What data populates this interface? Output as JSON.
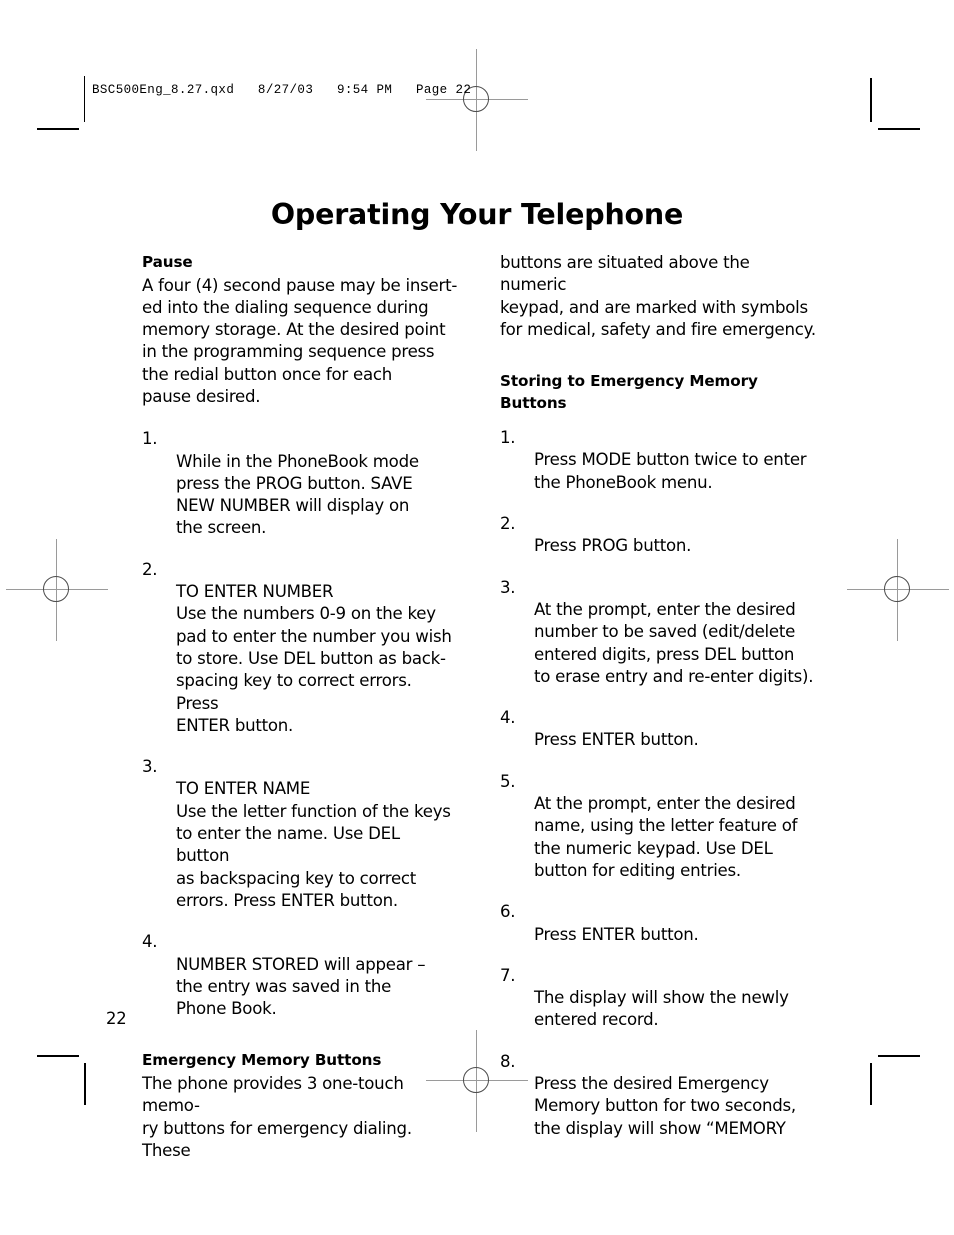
{
  "slug": {
    "text": "BSC500Eng_8.27.qxd   8/27/03   9:54 PM   Page 22"
  },
  "page": {
    "title": "Operating Your Telephone",
    "folio": "22"
  },
  "left_column": {
    "pause_heading": "Pause",
    "pause_body": "A four (4) second pause may be insert-\ned into the dialing sequence during\nmemory storage.  At the desired point\nin the programming sequence press\nthe redial button once for each\npause desired.",
    "pause_steps": [
      {
        "num": "1.",
        "text": "While in the PhoneBook mode\npress the PROG button. SAVE\nNEW NUMBER will display on\nthe screen."
      },
      {
        "num": "2.",
        "text": "TO ENTER NUMBER\nUse the numbers 0-9 on the key\npad to enter the number you wish\nto store. Use DEL button as back-\nspacing key to correct errors. Press\nENTER button."
      },
      {
        "num": "3.",
        "text": "TO ENTER NAME\nUse the letter function of the keys\nto enter the name. Use DEL button\nas backspacing key to correct\nerrors. Press ENTER button."
      },
      {
        "num": "4.",
        "text": "NUMBER STORED will appear –\nthe entry was saved in the\nPhone Book."
      }
    ],
    "emergency_heading": "Emergency Memory Buttons",
    "emergency_body": "The phone provides 3 one-touch memo-\nry buttons for emergency dialing. These"
  },
  "right_column": {
    "continuation_body": "buttons are situated above the numeric\nkeypad, and are marked with symbols\nfor medical, safety and fire emergency.",
    "storing_heading": "Storing to Emergency Memory\nButtons",
    "storing_steps": [
      {
        "num": "1.",
        "text": "Press MODE button twice to enter\nthe PhoneBook menu."
      },
      {
        "num": "2.",
        "text": "Press PROG button."
      },
      {
        "num": "3.",
        "text": "At the prompt, enter the desired\nnumber to be saved (edit/delete\nentered digits, press DEL button\nto erase entry and re-enter digits)."
      },
      {
        "num": "4.",
        "text": "Press ENTER button."
      },
      {
        "num": "5.",
        "text": "At the prompt, enter the desired\nname, using the letter feature of\nthe numeric keypad. Use DEL\nbutton for editing entries."
      },
      {
        "num": "6.",
        "text": "Press ENTER button."
      },
      {
        "num": "7.",
        "text": "The display will show the newly\nentered record."
      },
      {
        "num": "8.",
        "text": "Press the desired Emergency\nMemory button for two seconds,\nthe display will show “MEMORY"
      }
    ]
  },
  "colors": {
    "ink": "#000000",
    "paper": "#ffffff",
    "registration_gray": "#9a9a9a"
  }
}
